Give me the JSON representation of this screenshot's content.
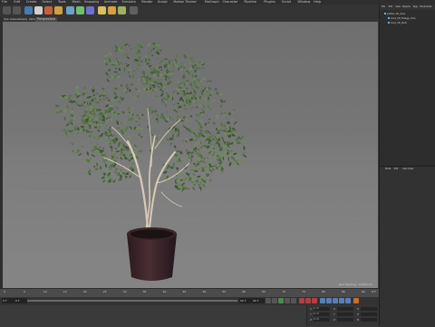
{
  "menubar": [
    "File",
    "Edit",
    "Create",
    "Select",
    "Tools",
    "Mesh",
    "Snapping",
    "Animate",
    "Simulate",
    "Render",
    "Sculpt",
    "Motion Tracker",
    "MoGraph",
    "Character",
    "Pipeline",
    "Plugins",
    "Script",
    "Window",
    "Help"
  ],
  "viewport": {
    "menu": [
      "View",
      "Cameras",
      "Display",
      "Options",
      "Filter",
      "Panel"
    ],
    "label": "Perspective",
    "status": "Grid Spacing : 10000 cm"
  },
  "timeline": {
    "ticks": [
      "0",
      "5",
      "10",
      "15",
      "20",
      "25",
      "30",
      "35",
      "40",
      "45",
      "50",
      "55",
      "60",
      "65",
      "70",
      "75",
      "80",
      "85",
      "90"
    ],
    "end_frame": "0 F"
  },
  "transport": {
    "start_field": "0 F",
    "current_field": "0 F",
    "end_field": "90 F",
    "end_field2": "90 F"
  },
  "coords": {
    "labels": [
      "X",
      "Y",
      "Z",
      "X",
      "Y",
      "Z",
      "H",
      "P",
      "B"
    ],
    "values": [
      "0 cm",
      "0 cm",
      "0 cm"
    ]
  },
  "object_manager": {
    "menu": [
      "File",
      "Edit",
      "View",
      "Objects",
      "Tags",
      "Bookmarks"
    ],
    "objects": [
      "potted_VR_olive",
      "olive_VR_foliage_olive",
      "olive_VR_stem"
    ]
  },
  "attribute_manager": {
    "menu": [
      "Mode",
      "Edit",
      "User Data"
    ]
  },
  "colors": {
    "foliage": "#4b6b3a",
    "foliage_light": "#6f8c5a",
    "trunk": "#d8cbb6",
    "pot": "#3a2428",
    "soil": "#1a1213"
  }
}
